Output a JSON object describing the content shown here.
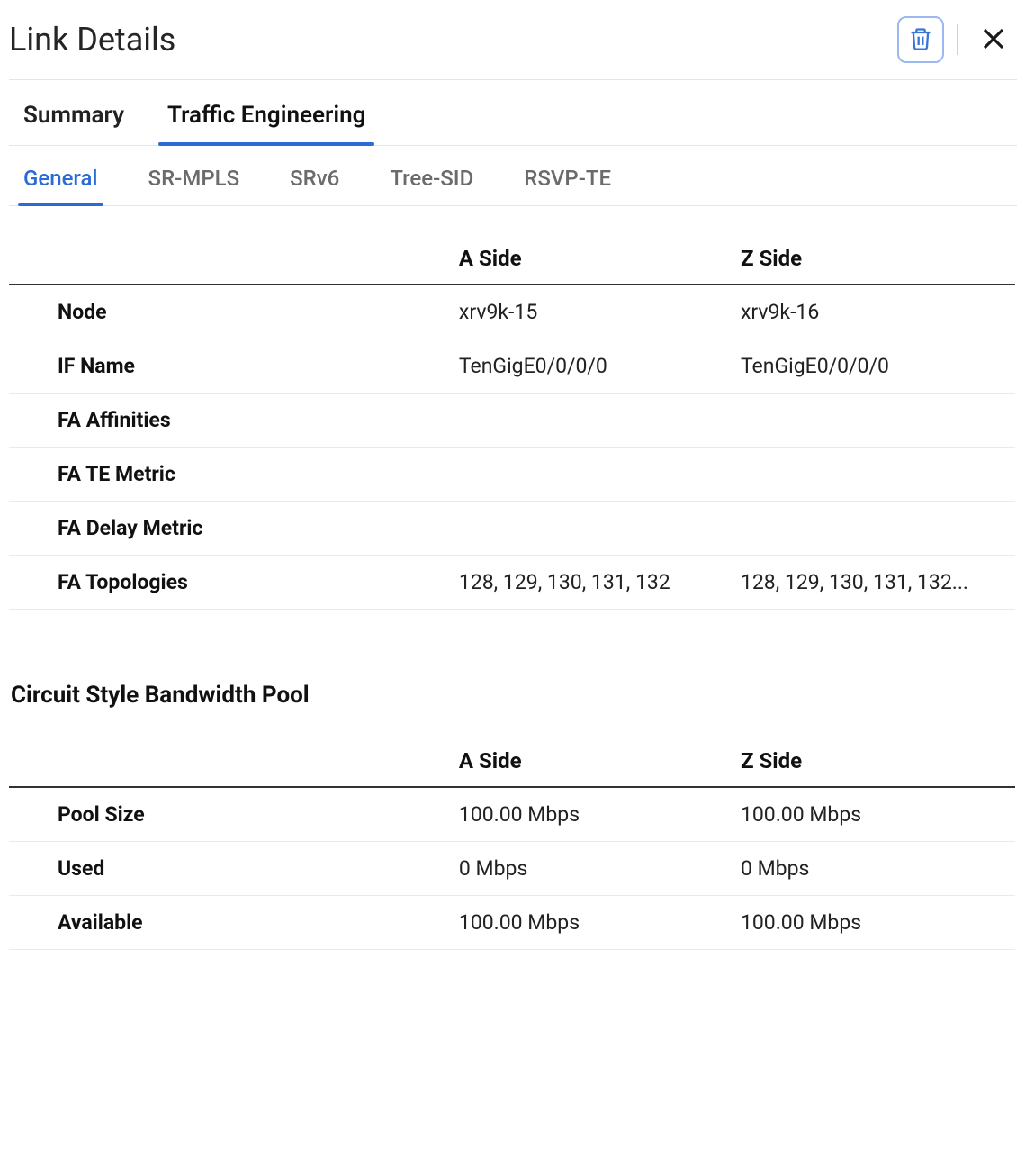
{
  "header": {
    "title": "Link Details"
  },
  "primaryTabs": [
    {
      "label": "Summary",
      "active": false
    },
    {
      "label": "Traffic Engineering",
      "active": true
    }
  ],
  "secondaryTabs": [
    {
      "label": "General",
      "active": true
    },
    {
      "label": "SR-MPLS",
      "active": false
    },
    {
      "label": "SRv6",
      "active": false
    },
    {
      "label": "Tree-SID",
      "active": false
    },
    {
      "label": "RSVP-TE",
      "active": false
    }
  ],
  "mainTable": {
    "columns": {
      "a": "A Side",
      "z": "Z Side"
    },
    "rows": [
      {
        "label": "Node",
        "a": "xrv9k-15",
        "z": "xrv9k-16"
      },
      {
        "label": "IF Name",
        "a": "TenGigE0/0/0/0",
        "z": "TenGigE0/0/0/0"
      },
      {
        "label": "FA Affinities",
        "a": "",
        "z": ""
      },
      {
        "label": "FA TE Metric",
        "a": "",
        "z": ""
      },
      {
        "label": "FA Delay Metric",
        "a": "",
        "z": ""
      },
      {
        "label": "FA Topologies",
        "a": "128, 129, 130, 131, 132",
        "z": "128, 129, 130, 131, 132..."
      }
    ]
  },
  "circuitSection": {
    "title": "Circuit Style Bandwidth Pool",
    "columns": {
      "a": "A Side",
      "z": "Z Side"
    },
    "rows": [
      {
        "label": "Pool Size",
        "a": "100.00 Mbps",
        "z": "100.00 Mbps"
      },
      {
        "label": "Used",
        "a": "0 Mbps",
        "z": "0 Mbps"
      },
      {
        "label": "Available",
        "a": "100.00 Mbps",
        "z": "100.00 Mbps"
      }
    ]
  }
}
